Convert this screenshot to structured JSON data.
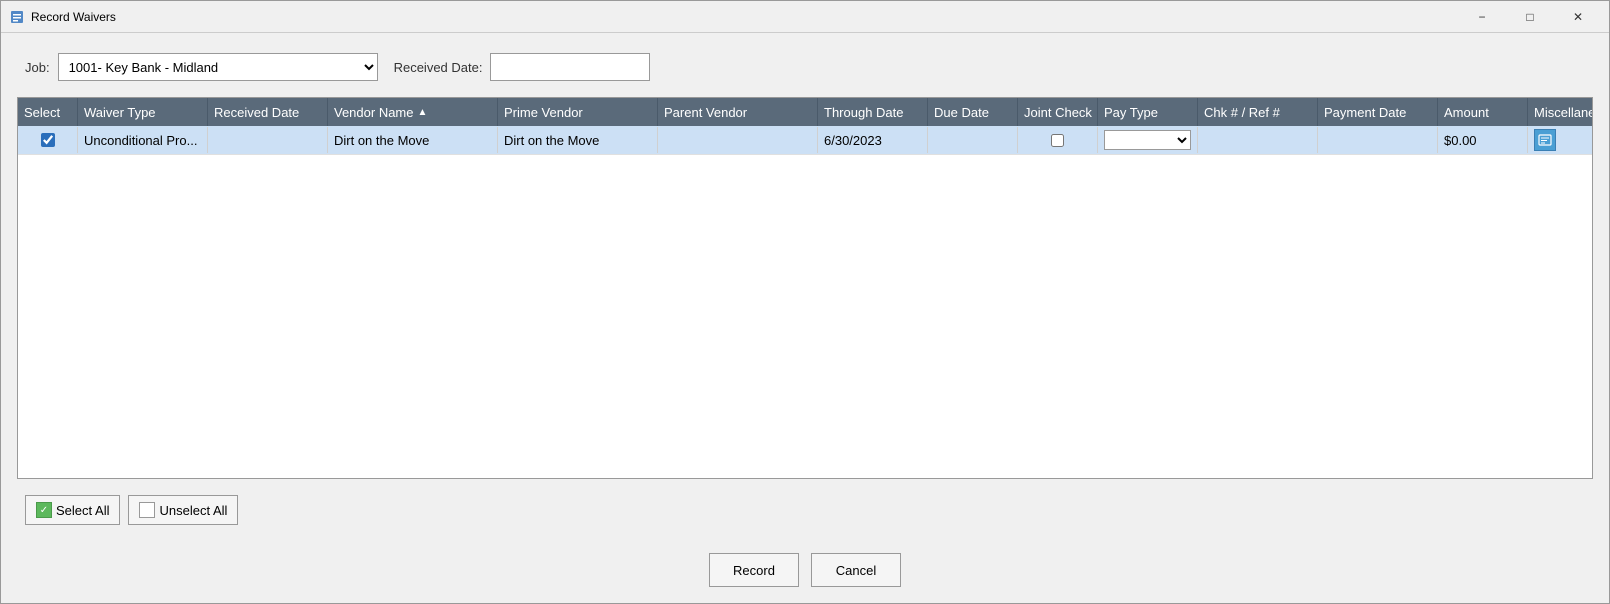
{
  "window": {
    "title": "Record Waivers"
  },
  "titlebar": {
    "minimize_label": "−",
    "maximize_label": "□",
    "close_label": "✕"
  },
  "form": {
    "job_label": "Job:",
    "received_date_label": "Received Date:",
    "job_value": "1001-  Key Bank - Midland",
    "received_date_value": ""
  },
  "grid": {
    "columns": [
      {
        "id": "select",
        "label": "Select"
      },
      {
        "id": "waiver_type",
        "label": "Waiver Type"
      },
      {
        "id": "received_date",
        "label": "Received Date"
      },
      {
        "id": "vendor_name",
        "label": "Vendor Name",
        "sort": "asc"
      },
      {
        "id": "prime_vendor",
        "label": "Prime Vendor"
      },
      {
        "id": "parent_vendor",
        "label": "Parent Vendor"
      },
      {
        "id": "through_date",
        "label": "Through Date"
      },
      {
        "id": "due_date",
        "label": "Due Date"
      },
      {
        "id": "joint_check",
        "label": "Joint Check"
      },
      {
        "id": "pay_type",
        "label": "Pay Type"
      },
      {
        "id": "chk_ref",
        "label": "Chk # / Ref #"
      },
      {
        "id": "payment_date",
        "label": "Payment Date"
      },
      {
        "id": "amount",
        "label": "Amount"
      },
      {
        "id": "miscellaneous",
        "label": "Miscellaneous"
      }
    ],
    "rows": [
      {
        "selected": true,
        "waiver_type": "Unconditional Pro...",
        "received_date": "",
        "vendor_name": "Dirt on the Move",
        "prime_vendor": "Dirt on the Move",
        "parent_vendor": "",
        "through_date": "6/30/2023",
        "due_date": "",
        "joint_check": false,
        "pay_type": "",
        "chk_ref": "",
        "payment_date": "",
        "amount": "$0.00",
        "miscellaneous": ""
      }
    ]
  },
  "bottom_actions": {
    "select_all_label": "Select All",
    "unselect_all_label": "Unselect All"
  },
  "footer": {
    "record_label": "Record",
    "cancel_label": "Cancel"
  }
}
